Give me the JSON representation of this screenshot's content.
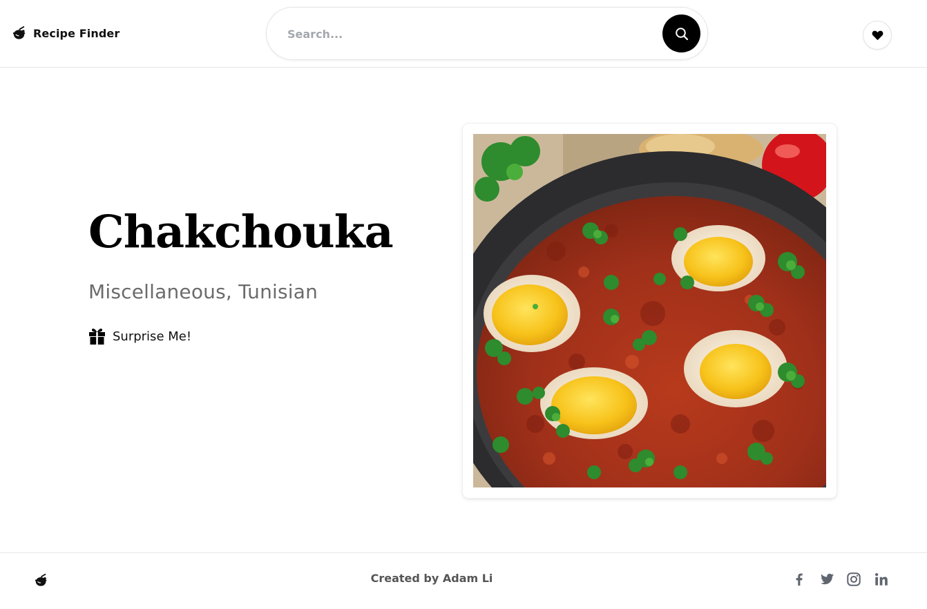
{
  "header": {
    "brand": {
      "title": "Recipe Finder",
      "icon": "pot-icon"
    },
    "search": {
      "placeholder": "Search...",
      "value": "",
      "button_icon": "search-icon"
    },
    "favorites_icon": "heart-icon"
  },
  "recipe": {
    "name": "Chakchouka",
    "meta": "Miscellaneous, Tunisian",
    "surprise_label": "Surprise Me!",
    "surprise_icon": "gift-icon",
    "image_alt": "Chakchouka"
  },
  "footer": {
    "credit": "Created by Adam Li",
    "logo_icon": "pot-icon",
    "social": [
      "facebook-icon",
      "twitter-icon",
      "instagram-icon",
      "linkedin-icon"
    ]
  },
  "colors": {
    "accent": "#000000",
    "muted_text": "#6b6b6b",
    "icon_gray": "#5f6670",
    "border": "#e6e6e6"
  }
}
